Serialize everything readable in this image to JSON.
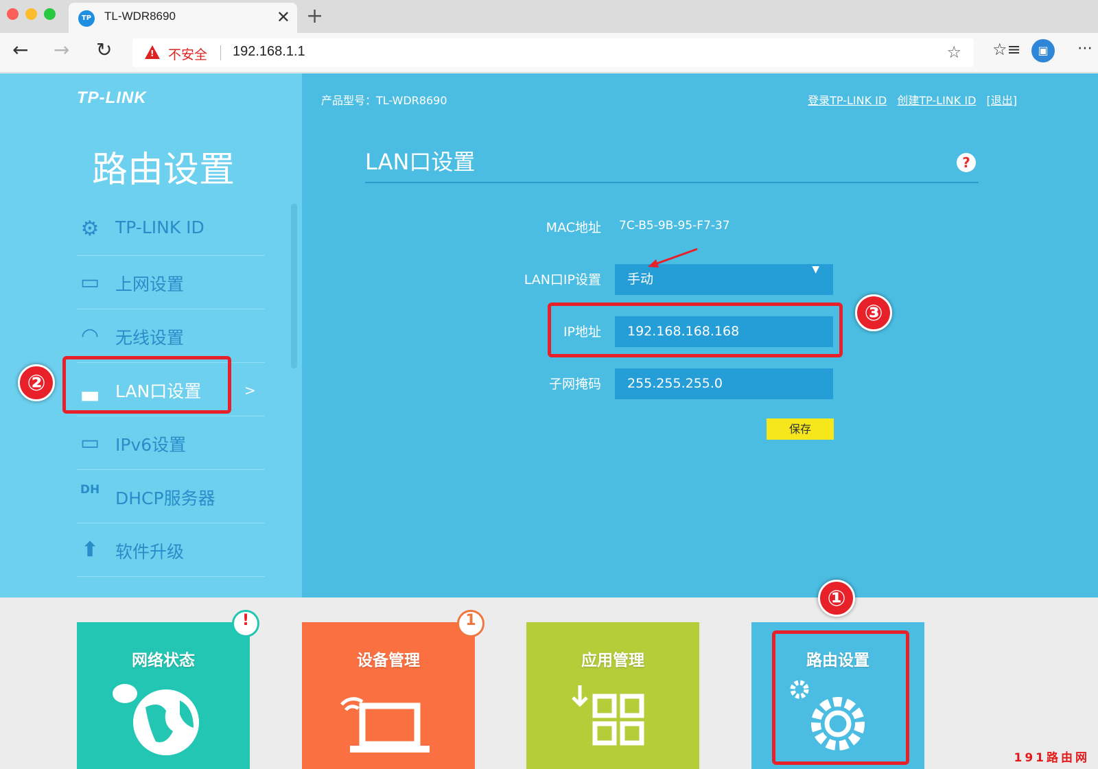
{
  "browser": {
    "tab_title": "TL-WDR8690",
    "tab_favicon": "TP",
    "tab_close": "✕",
    "new_tab": "+",
    "back": "←",
    "forward": "→",
    "reload": "↻",
    "security_warning": "不安全",
    "url": "192.168.1.1",
    "star": "☆",
    "favorites": "☆≡",
    "profile_icon": "▣",
    "more": "⋯"
  },
  "header": {
    "logo": "TP-LINK",
    "model": "产品型号：TL-WDR8690",
    "links": [
      "登录TP-LINK ID",
      "创建TP-LINK ID",
      "[退出]"
    ]
  },
  "sidebar": {
    "title": "路由设置",
    "items": [
      {
        "label": "TP-LINK ID",
        "icon": "gear-icon",
        "glyph": "⚙"
      },
      {
        "label": "上网设置",
        "icon": "laptop-icon",
        "glyph": "▭"
      },
      {
        "label": "无线设置",
        "icon": "wifi-icon",
        "glyph": "◠"
      },
      {
        "label": "LAN口设置",
        "icon": "ethernet-icon",
        "glyph": "▃",
        "active": true,
        "chevron": ">"
      },
      {
        "label": "IPv6设置",
        "icon": "laptop-icon",
        "glyph": "▭"
      },
      {
        "label": "DHCP服务器",
        "icon": "dhcp-icon",
        "glyph": "DH"
      },
      {
        "label": "软件升级",
        "icon": "upload-icon",
        "glyph": "⬆"
      }
    ]
  },
  "lan": {
    "section_title": "LAN口设置",
    "help": "?",
    "mac_label": "MAC地址",
    "mac_value": "7C-B5-9B-95-F7-37",
    "mode_label": "LAN口IP设置",
    "mode_value": "手动",
    "mode_arrow": "▼",
    "ip_label": "IP地址",
    "ip_value": "192.168.168.168",
    "mask_label": "子网掩码",
    "mask_value": "255.255.255.0",
    "save_label": "保存"
  },
  "annotations": {
    "step1": "①",
    "step2": "②",
    "step3": "③"
  },
  "tiles": [
    {
      "label": "网络状态",
      "color": "#23c6b3",
      "badge": "!"
    },
    {
      "label": "设备管理",
      "color": "#fb7040",
      "badge": "1"
    },
    {
      "label": "应用管理",
      "color": "#b5cd38"
    },
    {
      "label": "路由设置",
      "color": "#4bbde2"
    }
  ],
  "watermark": "191路由网",
  "colors": {
    "sidebar": "#6dd0ee",
    "main": "#4bbde2",
    "field": "#259ed8",
    "save": "#f5e71b",
    "annotation_red": "#e8202a"
  }
}
